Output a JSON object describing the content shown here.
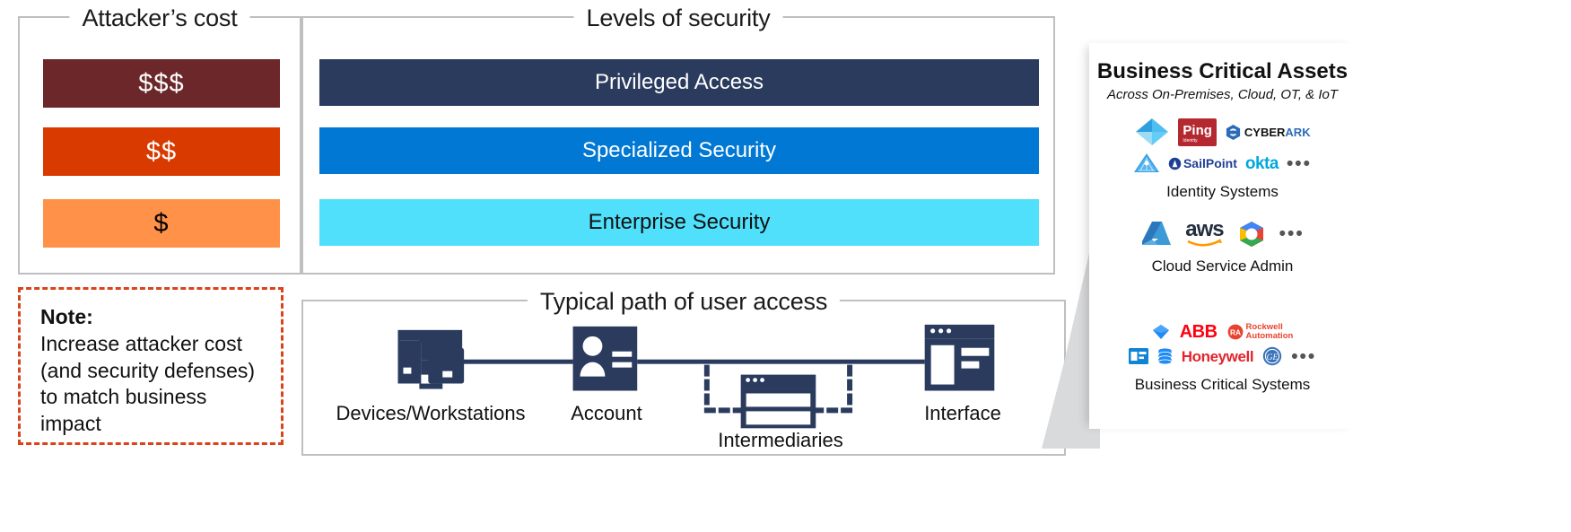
{
  "attacker": {
    "title": "Attacker’s cost",
    "bars": [
      {
        "label": "$$$",
        "color": "#6b2729"
      },
      {
        "label": "$$",
        "color": "#d93a00"
      },
      {
        "label": "$",
        "color": "#ff9248"
      }
    ]
  },
  "note": {
    "title": "Note:",
    "body": "Increase attacker cost (and security defenses) to match business impact",
    "border_color": "#d9441b"
  },
  "levels": {
    "title": "Levels of security",
    "bars": [
      {
        "label": "Privileged Access",
        "color": "#2a3b5e"
      },
      {
        "label": "Specialized Security",
        "color": "#0078d4"
      },
      {
        "label": "Enterprise Security",
        "color": "#50e0fb"
      }
    ]
  },
  "path": {
    "title": "Typical path of user access",
    "nodes": [
      {
        "label": "Devices/Workstations",
        "icon": "devices-workstations-icon"
      },
      {
        "label": "Account",
        "icon": "account-badge-icon"
      },
      {
        "label": "Intermediaries",
        "icon": "intermediaries-window-icon"
      },
      {
        "label": "Interface",
        "icon": "interface-window-icon"
      }
    ],
    "line_color": "#2a3b5e"
  },
  "assets": {
    "title": "Business Critical Assets",
    "subtitle": "Across On-Premises, Cloud, OT, & IoT",
    "groups": [
      {
        "label": "Identity Systems",
        "row1": [
          "Azure AD",
          "Ping Identity",
          "CYBERARK"
        ],
        "row2": [
          "Active Directory",
          "SailPoint",
          "okta"
        ],
        "more": "•••"
      },
      {
        "label": "Cloud Service Admin",
        "row1": [
          "Azure",
          "aws",
          "Google Cloud"
        ],
        "row2": [],
        "more": "•••"
      },
      {
        "label": "Business Critical Systems",
        "row1": [
          "SAP",
          "ABB",
          "Rockwell Automation"
        ],
        "row2": [
          "Dynamics",
          "Oracle",
          "Honeywell",
          "GE"
        ],
        "more": "•••"
      }
    ]
  }
}
